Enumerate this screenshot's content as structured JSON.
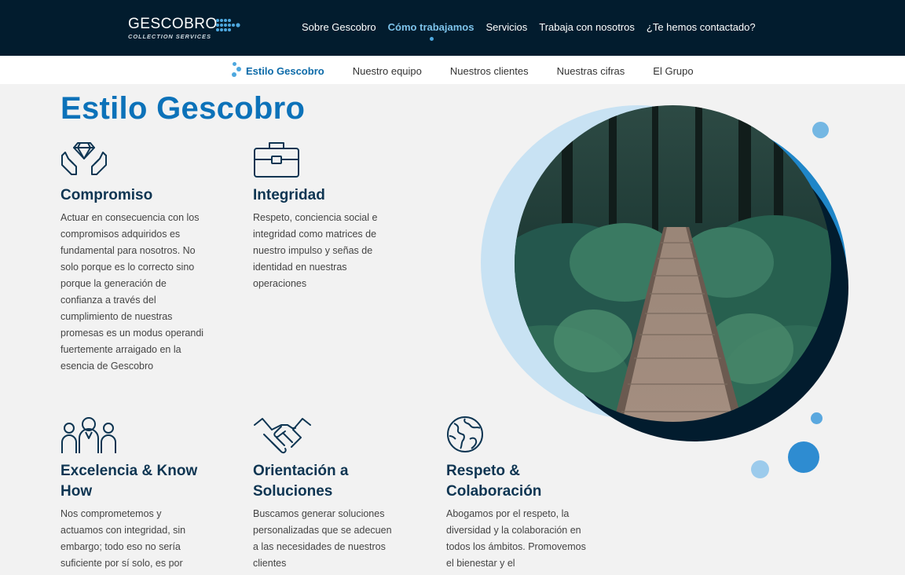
{
  "brand": {
    "name": "GESCOBRO",
    "tagline": "COLLECTION SERVICES"
  },
  "main_nav": [
    {
      "label": "Sobre Gescobro",
      "active": false
    },
    {
      "label": "Cómo trabajamos",
      "active": true
    },
    {
      "label": "Servicios",
      "active": false
    },
    {
      "label": "Trabaja con nosotros",
      "active": false
    },
    {
      "label": "¿Te hemos contactado?",
      "active": false
    }
  ],
  "sub_nav": [
    {
      "label": "Estilo Gescobro",
      "active": true
    },
    {
      "label": "Nuestro equipo",
      "active": false
    },
    {
      "label": "Nuestros clientes",
      "active": false
    },
    {
      "label": "Nuestras cifras",
      "active": false
    },
    {
      "label": "El Grupo",
      "active": false
    }
  ],
  "page_title": "Estilo Gescobro",
  "values": [
    {
      "icon": "hands-diamond-icon",
      "title": "Compromiso",
      "text": "Actuar en consecuencia con los compromisos adquiridos es fundamental para nosotros. No solo porque es lo correcto sino porque la generación de confianza a través del cumplimiento de nuestras promesas es un modus operandi fuertemente arraigado en la esencia de Gescobro"
    },
    {
      "icon": "briefcase-icon",
      "title": "Integridad",
      "text": "Respeto, conciencia social e integridad como matrices de nuestro impulso y señas de identidad en nuestras operaciones"
    },
    {
      "icon": "team-people-icon",
      "title": "Excelencia & Know How",
      "text": "Nos comprometemos y actuamos con integridad, sin embargo; todo eso no sería suficiente por sí solo, es por"
    },
    {
      "icon": "handshake-icon",
      "title": "Orientación a Soluciones",
      "text": "Buscamos generar soluciones personalizadas que se adecuen a las necesidades de nuestros clientes"
    },
    {
      "icon": "globe-icon",
      "title": "Respeto & Colaboración",
      "text": "Abogamos por el respeto, la diversidad y la colaboración en todos los ámbitos. Promovemos el bienestar y el"
    }
  ],
  "image": {
    "subject": "forest-boardwalk-photo"
  },
  "colors": {
    "navy": "#021c2e",
    "brand_blue": "#0c72b9",
    "accent_blue": "#4ea8df",
    "light_blue": "#c8e2f3",
    "heading_navy": "#0e3552"
  }
}
